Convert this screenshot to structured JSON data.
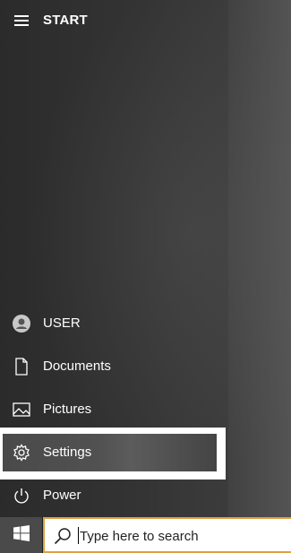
{
  "header": {
    "title": "START",
    "menu_icon": "hamburger-icon"
  },
  "menu": {
    "user": {
      "label": "USER",
      "icon": "user-avatar-icon"
    },
    "documents": {
      "label": "Documents",
      "icon": "document-icon"
    },
    "pictures": {
      "label": "Pictures",
      "icon": "picture-icon"
    },
    "settings": {
      "label": "Settings",
      "icon": "gear-icon",
      "highlighted": true
    },
    "power": {
      "label": "Power",
      "icon": "power-icon"
    }
  },
  "taskbar": {
    "start_icon": "windows-logo-icon",
    "search": {
      "placeholder": "Type here to search",
      "icon": "search-icon"
    },
    "accent_color": "#e0a040"
  }
}
